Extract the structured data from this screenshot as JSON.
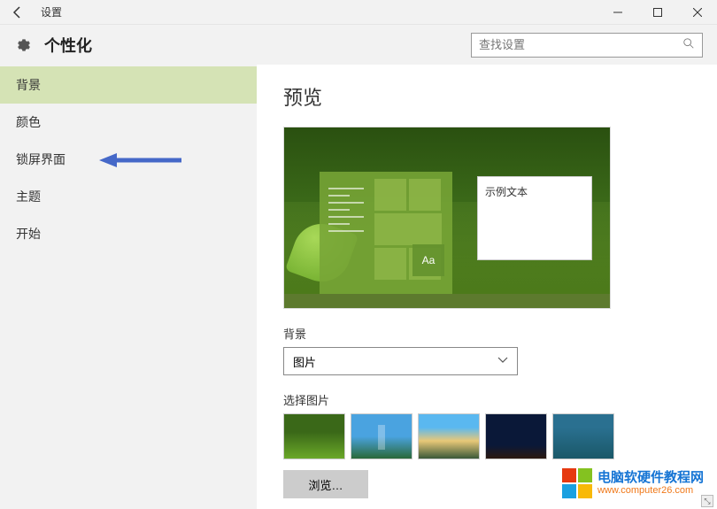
{
  "titlebar": {
    "title": "设置"
  },
  "header": {
    "page_title": "个性化",
    "search_placeholder": "查找设置"
  },
  "sidebar": {
    "items": [
      {
        "label": "背景",
        "active": true
      },
      {
        "label": "颜色",
        "active": false
      },
      {
        "label": "锁屏界面",
        "active": false
      },
      {
        "label": "主题",
        "active": false
      },
      {
        "label": "开始",
        "active": false
      }
    ]
  },
  "main": {
    "preview_title": "预览",
    "sample_text": "示例文本",
    "aa_label": "Aa",
    "background_label": "背景",
    "background_dropdown_value": "图片",
    "choose_picture_label": "选择图片",
    "browse_button": "浏览…"
  },
  "watermark": {
    "text_cn": "电脑软硬件教程网",
    "url": "www.computer26.com"
  }
}
